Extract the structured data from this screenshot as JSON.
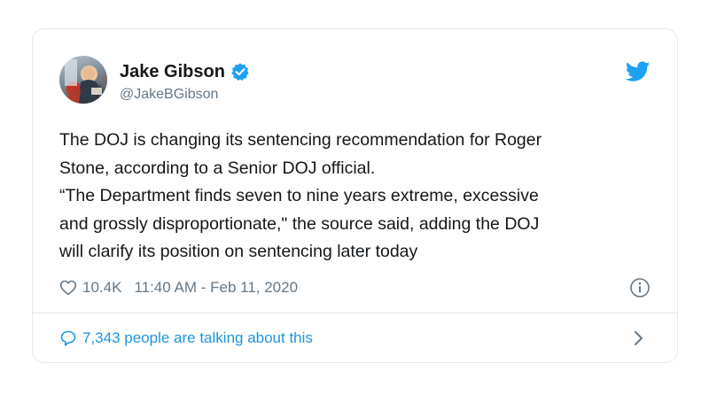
{
  "tweet": {
    "author": {
      "name": "Jake Gibson",
      "handle": "@JakeBGibson",
      "verified": true
    },
    "text_lines": [
      "The DOJ is changing its sentencing recommendation for Roger",
      "Stone, according to a Senior DOJ official.",
      "“The Department finds seven to nine years extreme, excessive",
      "and grossly disproportionate,\" the source said, adding the DOJ",
      "will clarify its position on sentencing later today"
    ],
    "likes": "10.4K",
    "timestamp": "11:40 AM - Feb 11, 2020",
    "talking": "7,343 people are talking about this"
  },
  "icons": {
    "brand": "twitter-bird-icon",
    "verified": "verified-badge-icon",
    "like": "heart-icon",
    "info": "info-icon",
    "comments": "speech-bubble-icon",
    "more": "chevron-right-icon"
  },
  "colors": {
    "twitter_blue": "#1da1f2",
    "link_blue": "#1b95e0",
    "secondary_text": "#657786",
    "border": "#e1e8ed"
  }
}
